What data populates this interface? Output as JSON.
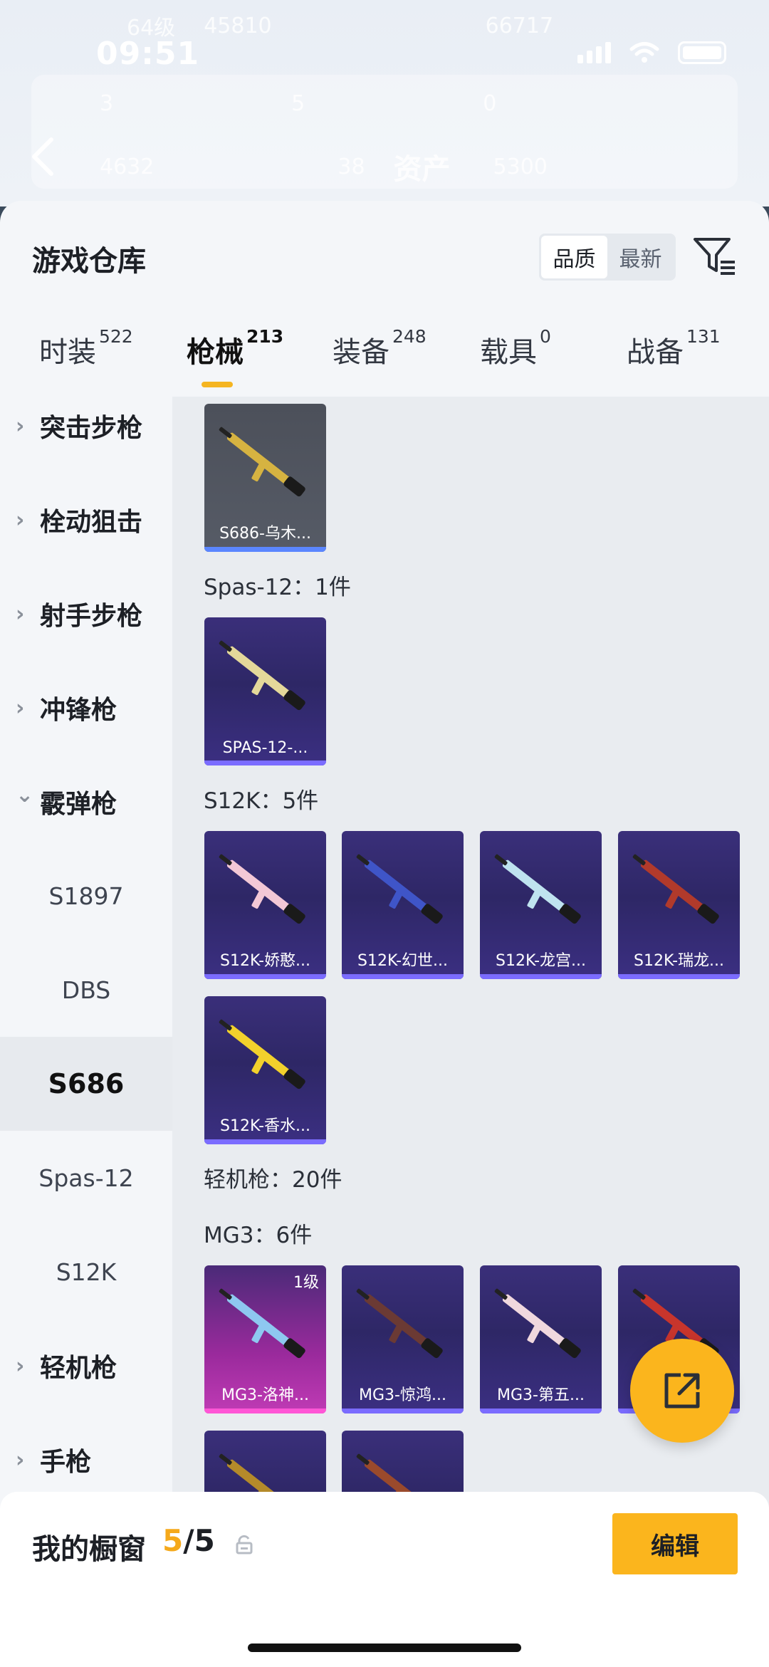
{
  "status_bar": {
    "time": "09:51"
  },
  "background": {
    "level_text": "64级",
    "stat_a": "45810",
    "stat_b": "66717",
    "row2": [
      "3",
      "5",
      "0"
    ],
    "row3": [
      "4632",
      "38",
      "5300"
    ],
    "page_title": "资产"
  },
  "sheet": {
    "title": "游戏仓库",
    "sort_options": [
      "品质",
      "最新"
    ],
    "sort_active": "品质"
  },
  "tabs": [
    {
      "label": "时装",
      "count": "522"
    },
    {
      "label": "枪械",
      "count": "213"
    },
    {
      "label": "装备",
      "count": "248"
    },
    {
      "label": "载具",
      "count": "0"
    },
    {
      "label": "战备",
      "count": "131"
    }
  ],
  "active_tab": "枪械",
  "sidebar": [
    {
      "label": "突击步枪",
      "type": "parent",
      "expanded": false
    },
    {
      "label": "栓动狙击",
      "type": "parent",
      "expanded": false
    },
    {
      "label": "射手步枪",
      "type": "parent",
      "expanded": false
    },
    {
      "label": "冲锋枪",
      "type": "parent",
      "expanded": false
    },
    {
      "label": "霰弹枪",
      "type": "parent",
      "expanded": true
    },
    {
      "label": "S1897",
      "type": "sub"
    },
    {
      "label": "DBS",
      "type": "sub"
    },
    {
      "label": "S686",
      "type": "sub",
      "selected": true
    },
    {
      "label": "Spas-12",
      "type": "sub"
    },
    {
      "label": "S12K",
      "type": "sub"
    },
    {
      "label": "轻机枪",
      "type": "parent",
      "expanded": false
    },
    {
      "label": "手枪",
      "type": "parent",
      "expanded": false
    }
  ],
  "groups": [
    {
      "label": "",
      "items": [
        {
          "name": "S686-乌木...",
          "style": "grey",
          "gun_color": "#d6b341"
        }
      ]
    },
    {
      "label": "Spas-12：1件",
      "items": [
        {
          "name": "SPAS-12-...",
          "style": "purple",
          "gun_color": "#e4d89a"
        }
      ]
    },
    {
      "label": "S12K：5件",
      "items": [
        {
          "name": "S12K-娇憨...",
          "style": "purple",
          "gun_color": "#f3c8d6"
        },
        {
          "name": "S12K-幻世...",
          "style": "purple",
          "gun_color": "#3f55c8"
        },
        {
          "name": "S12K-龙宫...",
          "style": "purple",
          "gun_color": "#bfe3ef"
        },
        {
          "name": "S12K-瑞龙...",
          "style": "purple",
          "gun_color": "#b13a2b"
        },
        {
          "name": "S12K-香水...",
          "style": "purple",
          "gun_color": "#f2d12c"
        }
      ]
    },
    {
      "label": "轻机枪：20件",
      "items": []
    },
    {
      "label": "MG3：6件",
      "items": [
        {
          "name": "MG3-洛神...",
          "style": "pink",
          "gun_color": "#8ec8f0",
          "level": "1级"
        },
        {
          "name": "MG3-惊鸿...",
          "style": "purple",
          "gun_color": "#6b3a34"
        },
        {
          "name": "MG3-第五...",
          "style": "purple",
          "gun_color": "#f0d8de"
        },
        {
          "name": "",
          "style": "purple",
          "gun_color": "#c8352c"
        },
        {
          "name": "",
          "style": "purple",
          "gun_color": "#b48a2a"
        },
        {
          "name": "",
          "style": "purple",
          "gun_color": "#9a4a2c"
        }
      ]
    }
  ],
  "showcase": {
    "label": "我的橱窗",
    "current": "5",
    "total": "/5",
    "edit_label": "编辑"
  },
  "colors": {
    "accent": "#fbb51d",
    "card_bar": "#7b6cff",
    "card_bar_pink": "#ff56d6"
  }
}
